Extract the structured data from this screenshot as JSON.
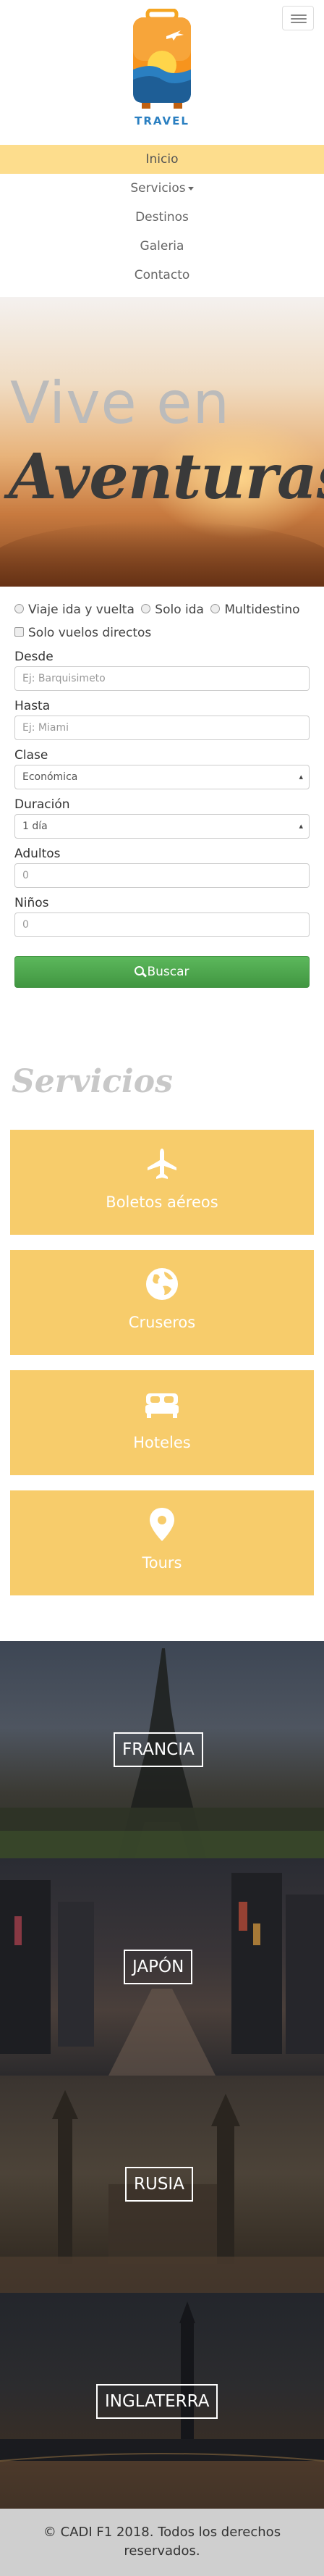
{
  "header": {
    "logo_text": "TRAVEL"
  },
  "nav": {
    "items": [
      {
        "label": "Inicio"
      },
      {
        "label": "Servicios"
      },
      {
        "label": "Destinos"
      },
      {
        "label": "Galeria"
      },
      {
        "label": "Contacto"
      }
    ]
  },
  "hero": {
    "line1": "Vive en",
    "line2": "Aventuras"
  },
  "form": {
    "trip_types": [
      "Viaje ida y vuelta",
      "Solo ida",
      "Multidestino"
    ],
    "direct_only": "Solo vuelos directos",
    "from_label": "Desde",
    "from_placeholder": "Ej: Barquisimeto",
    "to_label": "Hasta",
    "to_placeholder": "Ej: Miami",
    "class_label": "Clase",
    "class_value": "Económica",
    "duration_label": "Duración",
    "duration_value": "1 día",
    "adults_label": "Adultos",
    "adults_value": "0",
    "children_label": "Niños",
    "children_value": "0",
    "search_label": "Buscar"
  },
  "services": {
    "title": "Servicios",
    "cards": [
      {
        "label": "Boletos aéreos",
        "icon": "plane-icon"
      },
      {
        "label": "Cruseros",
        "icon": "globe-icon"
      },
      {
        "label": "Hoteles",
        "icon": "bed-icon"
      },
      {
        "label": "Tours",
        "icon": "map-marker-icon"
      }
    ],
    "card_color": "#f7cc6b"
  },
  "destinations": [
    {
      "label": "FRANCIA"
    },
    {
      "label": "JAPÓN"
    },
    {
      "label": "RUSIA"
    },
    {
      "label": "INGLATERRA"
    }
  ],
  "footer": {
    "line1": "© CADI F1 2018. Todos los derechos",
    "line2": "reservados."
  },
  "colors": {
    "accent": "#fddd8d",
    "button": "#4cae4c"
  }
}
